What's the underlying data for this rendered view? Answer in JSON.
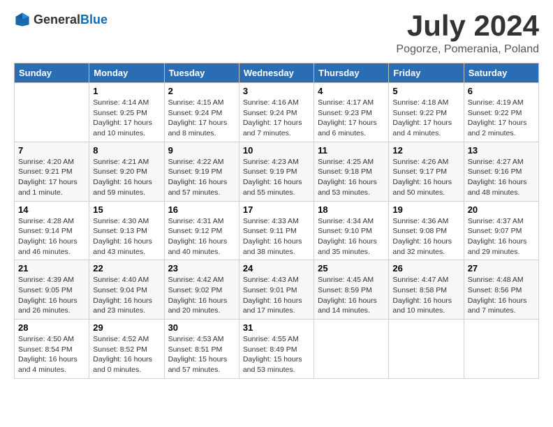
{
  "header": {
    "logo_general": "General",
    "logo_blue": "Blue",
    "month_title": "July 2024",
    "location": "Pogorze, Pomerania, Poland"
  },
  "days_of_week": [
    "Sunday",
    "Monday",
    "Tuesday",
    "Wednesday",
    "Thursday",
    "Friday",
    "Saturday"
  ],
  "weeks": [
    [
      {
        "day": "",
        "info": ""
      },
      {
        "day": "1",
        "info": "Sunrise: 4:14 AM\nSunset: 9:25 PM\nDaylight: 17 hours\nand 10 minutes."
      },
      {
        "day": "2",
        "info": "Sunrise: 4:15 AM\nSunset: 9:24 PM\nDaylight: 17 hours\nand 8 minutes."
      },
      {
        "day": "3",
        "info": "Sunrise: 4:16 AM\nSunset: 9:24 PM\nDaylight: 17 hours\nand 7 minutes."
      },
      {
        "day": "4",
        "info": "Sunrise: 4:17 AM\nSunset: 9:23 PM\nDaylight: 17 hours\nand 6 minutes."
      },
      {
        "day": "5",
        "info": "Sunrise: 4:18 AM\nSunset: 9:22 PM\nDaylight: 17 hours\nand 4 minutes."
      },
      {
        "day": "6",
        "info": "Sunrise: 4:19 AM\nSunset: 9:22 PM\nDaylight: 17 hours\nand 2 minutes."
      }
    ],
    [
      {
        "day": "7",
        "info": "Sunrise: 4:20 AM\nSunset: 9:21 PM\nDaylight: 17 hours\nand 1 minute."
      },
      {
        "day": "8",
        "info": "Sunrise: 4:21 AM\nSunset: 9:20 PM\nDaylight: 16 hours\nand 59 minutes."
      },
      {
        "day": "9",
        "info": "Sunrise: 4:22 AM\nSunset: 9:19 PM\nDaylight: 16 hours\nand 57 minutes."
      },
      {
        "day": "10",
        "info": "Sunrise: 4:23 AM\nSunset: 9:19 PM\nDaylight: 16 hours\nand 55 minutes."
      },
      {
        "day": "11",
        "info": "Sunrise: 4:25 AM\nSunset: 9:18 PM\nDaylight: 16 hours\nand 53 minutes."
      },
      {
        "day": "12",
        "info": "Sunrise: 4:26 AM\nSunset: 9:17 PM\nDaylight: 16 hours\nand 50 minutes."
      },
      {
        "day": "13",
        "info": "Sunrise: 4:27 AM\nSunset: 9:16 PM\nDaylight: 16 hours\nand 48 minutes."
      }
    ],
    [
      {
        "day": "14",
        "info": "Sunrise: 4:28 AM\nSunset: 9:14 PM\nDaylight: 16 hours\nand 46 minutes."
      },
      {
        "day": "15",
        "info": "Sunrise: 4:30 AM\nSunset: 9:13 PM\nDaylight: 16 hours\nand 43 minutes."
      },
      {
        "day": "16",
        "info": "Sunrise: 4:31 AM\nSunset: 9:12 PM\nDaylight: 16 hours\nand 40 minutes."
      },
      {
        "day": "17",
        "info": "Sunrise: 4:33 AM\nSunset: 9:11 PM\nDaylight: 16 hours\nand 38 minutes."
      },
      {
        "day": "18",
        "info": "Sunrise: 4:34 AM\nSunset: 9:10 PM\nDaylight: 16 hours\nand 35 minutes."
      },
      {
        "day": "19",
        "info": "Sunrise: 4:36 AM\nSunset: 9:08 PM\nDaylight: 16 hours\nand 32 minutes."
      },
      {
        "day": "20",
        "info": "Sunrise: 4:37 AM\nSunset: 9:07 PM\nDaylight: 16 hours\nand 29 minutes."
      }
    ],
    [
      {
        "day": "21",
        "info": "Sunrise: 4:39 AM\nSunset: 9:05 PM\nDaylight: 16 hours\nand 26 minutes."
      },
      {
        "day": "22",
        "info": "Sunrise: 4:40 AM\nSunset: 9:04 PM\nDaylight: 16 hours\nand 23 minutes."
      },
      {
        "day": "23",
        "info": "Sunrise: 4:42 AM\nSunset: 9:02 PM\nDaylight: 16 hours\nand 20 minutes."
      },
      {
        "day": "24",
        "info": "Sunrise: 4:43 AM\nSunset: 9:01 PM\nDaylight: 16 hours\nand 17 minutes."
      },
      {
        "day": "25",
        "info": "Sunrise: 4:45 AM\nSunset: 8:59 PM\nDaylight: 16 hours\nand 14 minutes."
      },
      {
        "day": "26",
        "info": "Sunrise: 4:47 AM\nSunset: 8:58 PM\nDaylight: 16 hours\nand 10 minutes."
      },
      {
        "day": "27",
        "info": "Sunrise: 4:48 AM\nSunset: 8:56 PM\nDaylight: 16 hours\nand 7 minutes."
      }
    ],
    [
      {
        "day": "28",
        "info": "Sunrise: 4:50 AM\nSunset: 8:54 PM\nDaylight: 16 hours\nand 4 minutes."
      },
      {
        "day": "29",
        "info": "Sunrise: 4:52 AM\nSunset: 8:52 PM\nDaylight: 16 hours\nand 0 minutes."
      },
      {
        "day": "30",
        "info": "Sunrise: 4:53 AM\nSunset: 8:51 PM\nDaylight: 15 hours\nand 57 minutes."
      },
      {
        "day": "31",
        "info": "Sunrise: 4:55 AM\nSunset: 8:49 PM\nDaylight: 15 hours\nand 53 minutes."
      },
      {
        "day": "",
        "info": ""
      },
      {
        "day": "",
        "info": ""
      },
      {
        "day": "",
        "info": ""
      }
    ]
  ]
}
